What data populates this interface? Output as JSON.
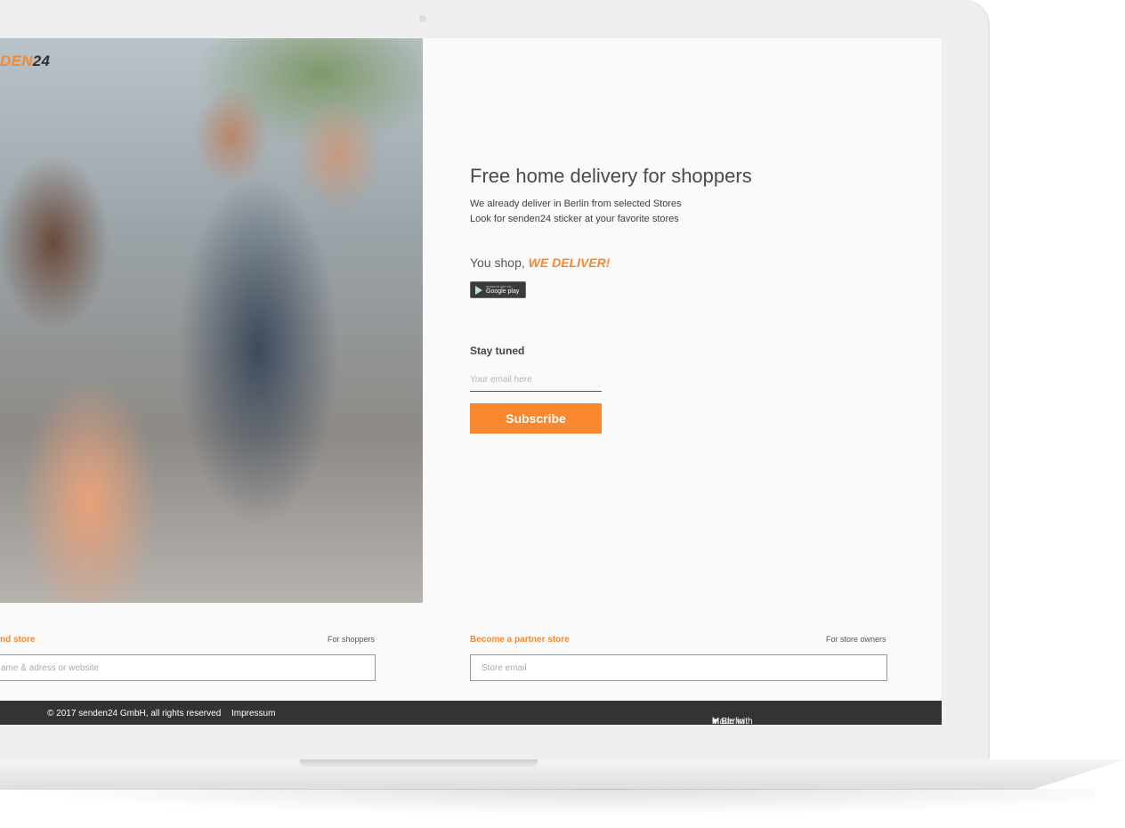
{
  "logo": {
    "part1": "DEN",
    "part2": "24"
  },
  "hero": {
    "headline": "Free home delivery for shoppers",
    "line1": "We already deliver in Berlin from selected Stores",
    "line2": "Look for senden24 sticker at your favorite stores",
    "tagline_prefix": "You shop,",
    "tagline_emphasis": "WE DELIVER!"
  },
  "google_play": {
    "top": "ANDROID APP ON",
    "main": "Google play"
  },
  "newsletter": {
    "label": "Stay tuned",
    "placeholder": "Your email here",
    "button": "Subscribe"
  },
  "finder_left": {
    "label": "nd store",
    "tag": "For shoppers",
    "placeholder": "ame & adress or website"
  },
  "finder_right": {
    "label": "Become a partner store",
    "tag": "For store owners",
    "placeholder": "Store email"
  },
  "footer": {
    "copyright": "© 2017 senden24 GmbH, all rights reserved",
    "impressum": "Impressum",
    "made_prefix": "Made with",
    "made_suffix": "in Berlin"
  },
  "colors": {
    "accent": "#f7882f",
    "footer_bg": "#333333"
  }
}
